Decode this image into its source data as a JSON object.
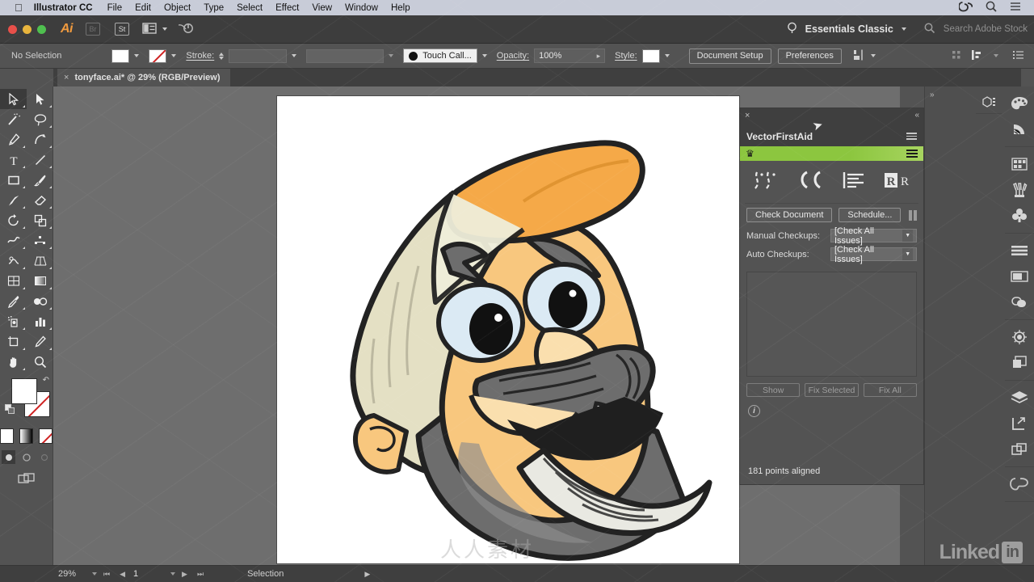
{
  "macmenu": {
    "apple_icon": "apple-icon",
    "app_name": "Illustrator CC",
    "items": [
      "File",
      "Edit",
      "Object",
      "Type",
      "Select",
      "Effect",
      "View",
      "Window",
      "Help"
    ],
    "right_icons": [
      "creative-cloud-icon",
      "search-icon",
      "list-icon"
    ]
  },
  "appbar": {
    "logo": "Ai",
    "bridge_label": "Br",
    "stock_label": "St",
    "arrange_icon": "arrange-documents-icon",
    "power_icon": "power-icon",
    "search_hint_icon": "bulb-icon",
    "workspace": "Essentials Classic",
    "search_placeholder": "Search Adobe Stock"
  },
  "controlbar": {
    "selection_status": "No Selection",
    "fill_label": "fill-swatch",
    "stroke_swatch_label": "stroke-swatch",
    "stroke_label": "Stroke:",
    "stroke_weight": "",
    "stroke_profile": "",
    "brush_definition": "Touch Call...",
    "opacity_label": "Opacity:",
    "opacity_value": "100%",
    "style_label": "Style:",
    "document_setup": "Document Setup",
    "preferences": "Preferences",
    "align_icon": "align-icon"
  },
  "tab": {
    "close_icon": "×",
    "title": "tonyface.ai* @ 29% (RGB/Preview)"
  },
  "toolbar": {
    "tools": [
      {
        "name": "selection-tool",
        "selected": true
      },
      {
        "name": "direct-selection-tool",
        "selected": false
      },
      {
        "name": "magic-wand-tool",
        "selected": false
      },
      {
        "name": "lasso-tool",
        "selected": false
      },
      {
        "name": "pen-tool",
        "selected": false
      },
      {
        "name": "curvature-tool",
        "selected": false
      },
      {
        "name": "type-tool",
        "selected": false
      },
      {
        "name": "line-segment-tool",
        "selected": false
      },
      {
        "name": "rectangle-tool",
        "selected": false
      },
      {
        "name": "paintbrush-tool",
        "selected": false
      },
      {
        "name": "shaper-tool",
        "selected": false
      },
      {
        "name": "eraser-tool",
        "selected": false
      },
      {
        "name": "rotate-tool",
        "selected": false
      },
      {
        "name": "scale-tool",
        "selected": false
      },
      {
        "name": "width-tool",
        "selected": false
      },
      {
        "name": "free-transform-tool",
        "selected": false
      },
      {
        "name": "shape-builder-tool",
        "selected": false
      },
      {
        "name": "perspective-grid-tool",
        "selected": false
      },
      {
        "name": "mesh-tool",
        "selected": false
      },
      {
        "name": "gradient-tool",
        "selected": false
      },
      {
        "name": "eyedropper-tool",
        "selected": false
      },
      {
        "name": "blend-tool",
        "selected": false
      },
      {
        "name": "symbol-sprayer-tool",
        "selected": false
      },
      {
        "name": "column-graph-tool",
        "selected": false
      },
      {
        "name": "artboard-tool",
        "selected": false
      },
      {
        "name": "slice-tool",
        "selected": false
      },
      {
        "name": "puppet-warp-tool",
        "selected": false
      },
      {
        "name": "hand-tool",
        "selected": false
      },
      {
        "name": "zoom-tool",
        "selected": false
      }
    ],
    "fill_color": "#ffffff",
    "stroke_color": "none",
    "swap_icon": "swap-fill-stroke-icon",
    "default_icon": "default-fill-stroke-icon",
    "paint_modes": [
      "color-mode",
      "gradient-mode",
      "none-mode"
    ],
    "draw_modes": [
      "draw-normal",
      "draw-behind",
      "draw-inside"
    ],
    "screen_mode": "change-screen-mode-icon"
  },
  "panel": {
    "close_icon": "×",
    "collapse_icon": "«",
    "title": "VectorFirstAid",
    "menu_icon": "panel-menu-icon",
    "banner_icon": "crown-icon",
    "banner_menu_icon": "banner-menu-icon",
    "tool_icons": [
      "clean-paths-icon",
      "smooth-curves-icon",
      "align-text-icon",
      "replace-font-icon"
    ],
    "check_document": "Check Document",
    "schedule": "Schedule...",
    "pause_icon": "pause-icon",
    "manual_label": "Manual Checkups:",
    "manual_value": "[Check All Issues]",
    "auto_label": "Auto Checkups:",
    "auto_value": "[Check All Issues]",
    "show_button": "Show",
    "fix_selected_button": "Fix Selected",
    "fix_all_button": "Fix All",
    "info_icon": "info-icon",
    "status": "181 points aligned"
  },
  "dock": {
    "icons": [
      "color-panel-icon",
      "color-guide-icon",
      "swatches-panel-icon",
      "brushes-panel-icon",
      "symbols-panel-icon",
      "align-panel-icon",
      "transform-panel-icon",
      "pathfinder-panel-icon",
      "appearance-panel-icon",
      "graphic-styles-icon",
      "layers-panel-icon",
      "artboards-panel-icon",
      "asset-export-icon",
      "libraries-panel-icon"
    ],
    "top_icon": "3d-panel-icon"
  },
  "statusbar": {
    "zoom": "29%",
    "first_icon": "first-artboard-icon",
    "prev_icon": "prev-artboard-icon",
    "page": "1",
    "next_icon": "next-artboard-icon",
    "last_icon": "last-artboard-icon",
    "status_text": "Selection",
    "menu_arrow": "status-menu-icon"
  },
  "watermark": {
    "linkedin_text": "Linked",
    "linkedin_badge": "in",
    "center_text": "人人素材"
  },
  "artwork": {
    "name": "cartoon-cowboy-face",
    "colors": {
      "hat_crown": "#e4e0c4",
      "hat_brim": "#f5a948",
      "skin": "#f8c77e",
      "skin_light": "#fadfae",
      "beard_dark": "#6d6d6d",
      "beard_light": "#dcdcd4",
      "eye_white": "#dbeaf4",
      "outline": "#222222"
    }
  }
}
